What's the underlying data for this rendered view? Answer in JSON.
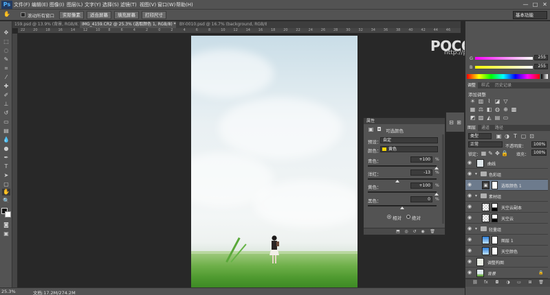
{
  "app": {
    "logo": "Ps"
  },
  "menu": [
    "文件(F)",
    "编辑(E)",
    "图像(I)",
    "图层(L)",
    "文字(Y)",
    "选择(S)",
    "滤镜(T)",
    "视图(V)",
    "窗口(W)",
    "帮助(H)"
  ],
  "window_controls": [
    "—",
    "□",
    "✕"
  ],
  "options": {
    "scroll_all_label": "滚动所有窗口",
    "buttons": [
      "实际像素",
      "适合屏幕",
      "填充屏幕",
      "打印尺寸"
    ],
    "workspace": "基本功能"
  },
  "tabs": [
    {
      "label": "159.psd @ 13.9% (背景, RGB/8) *",
      "active": false
    },
    {
      "label": "IMG_4159.CR2 @ 25.3% (选取颜色 1, RGB/8) *",
      "active": true
    },
    {
      "label": "BY-0010.psd @ 16.7% (background, RGB/8) *",
      "active": false
    }
  ],
  "ruler_ticks": [
    "22",
    "20",
    "18",
    "16",
    "14",
    "12",
    "10",
    "8",
    "6",
    "4",
    "2",
    "0",
    "2",
    "4",
    "6",
    "8",
    "10",
    "12",
    "14",
    "16",
    "18",
    "20",
    "22",
    "24",
    "26",
    "28",
    "30",
    "32",
    "34",
    "36",
    "38",
    "40",
    "42",
    "44",
    "46"
  ],
  "watermark": {
    "logo": "POCO 摄影专题",
    "url": "http://photo.poco.cn/"
  },
  "properties": {
    "panel_label": "属性",
    "title": "可选颜色",
    "preset_label": "预设：",
    "preset_value": "自定",
    "color_label": "颜色：",
    "color_value": "黄色",
    "color_swatch": "#f5d400",
    "sliders": [
      {
        "label": "青色：",
        "value": "+100",
        "pos": 1.0
      },
      {
        "label": "洋红：",
        "value": "-13",
        "pos": 0.435
      },
      {
        "label": "黄色：",
        "value": "+100",
        "pos": 1.0
      },
      {
        "label": "黑色：",
        "value": "0",
        "pos": 0.5
      }
    ],
    "pct": "%",
    "method_relative": "相对",
    "method_absolute": "绝对",
    "method_selected": "relative"
  },
  "dock": {
    "rgb": [
      {
        "label": "G",
        "value": "255"
      },
      {
        "label": "B",
        "value": "255"
      }
    ],
    "adj_tabs": [
      "调整",
      "样式",
      "历史记录"
    ],
    "add_adjustment": "添加调整",
    "layer_tabs": [
      "图层",
      "通道",
      "路径"
    ],
    "filter_kind": "类型",
    "blend_mode": "正常",
    "opacity_label": "不透明度：",
    "opacity": "100%",
    "lock_label": "锁定：",
    "fill_label": "填充：",
    "fill": "100%",
    "layers": [
      {
        "name": "曲线",
        "type": "layer",
        "indent": 0,
        "selected": false,
        "thumb": "#dfe6ea"
      },
      {
        "name": "色彩组",
        "type": "group",
        "indent": 0,
        "selected": false
      },
      {
        "name": "选取颜色 1",
        "type": "adjust",
        "indent": 1,
        "selected": true
      },
      {
        "name": "素材组",
        "type": "group",
        "indent": 0,
        "selected": false
      },
      {
        "name": "天空云副本",
        "type": "checker",
        "indent": 1,
        "selected": false
      },
      {
        "name": "天空云",
        "type": "checker",
        "indent": 1,
        "selected": false
      },
      {
        "name": "轻量组",
        "type": "group",
        "indent": 0,
        "selected": false
      },
      {
        "name": "图层 1",
        "type": "sky",
        "indent": 1,
        "selected": false
      },
      {
        "name": "天空颜色",
        "type": "sky",
        "indent": 1,
        "selected": false
      },
      {
        "name": "调整构图",
        "type": "layer",
        "indent": 0,
        "selected": false,
        "thumb": "#e8ece4"
      },
      {
        "name": "背景",
        "type": "bg",
        "indent": 0,
        "selected": false
      }
    ]
  },
  "status": {
    "zoom": "25.3%",
    "doc": "文档:17.2M/274.2M"
  }
}
